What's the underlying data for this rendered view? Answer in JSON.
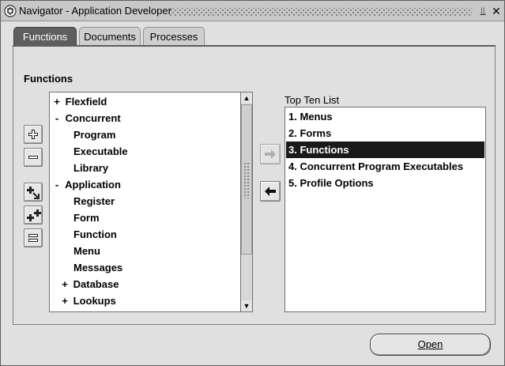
{
  "window": {
    "title": "Navigator - Application Developer",
    "minimize_glyph": "⫫",
    "close_glyph": "✕"
  },
  "tabs": [
    {
      "label": "Functions",
      "active": true
    },
    {
      "label": "Documents",
      "active": false
    },
    {
      "label": "Processes",
      "active": false
    }
  ],
  "main": {
    "section_label": "Functions",
    "side_buttons": [
      "expand-icon",
      "collapse-icon",
      "expand-branch-icon",
      "expand-all-icon",
      "collapse-all-icon"
    ],
    "tree": [
      {
        "label": "Flexfield",
        "toggle": "+",
        "level": 0
      },
      {
        "label": "Concurrent",
        "toggle": "-",
        "level": 0
      },
      {
        "label": "Program",
        "toggle": "",
        "level": 1
      },
      {
        "label": "Executable",
        "toggle": "",
        "level": 1
      },
      {
        "label": "Library",
        "toggle": "",
        "level": 1
      },
      {
        "label": "Application",
        "toggle": "-",
        "level": 0
      },
      {
        "label": "Register",
        "toggle": "",
        "level": 1
      },
      {
        "label": "Form",
        "toggle": "",
        "level": 1
      },
      {
        "label": "Function",
        "toggle": "",
        "level": 1
      },
      {
        "label": "Menu",
        "toggle": "",
        "level": 1
      },
      {
        "label": "Messages",
        "toggle": "",
        "level": 1
      },
      {
        "label": "Database",
        "toggle": "+",
        "level": 1
      },
      {
        "label": "Lookups",
        "toggle": "+",
        "level": 1
      }
    ],
    "top_ten_label": "Top Ten List",
    "top_ten": [
      {
        "label": "1. Menus",
        "selected": false
      },
      {
        "label": "2. Forms",
        "selected": false
      },
      {
        "label": "3. Functions",
        "selected": true
      },
      {
        "label": "4. Concurrent Program Executables",
        "selected": false
      },
      {
        "label": "5. Profile Options",
        "selected": false
      }
    ],
    "add_to_list_icon": "arrow-right-icon",
    "remove_from_list_icon": "arrow-left-icon"
  },
  "footer": {
    "open_button": "Open"
  },
  "colors": {
    "selected_bg": "#1a1a1a",
    "active_tab_bg": "#5e5e5e",
    "window_bg": "#e0e0e0"
  }
}
